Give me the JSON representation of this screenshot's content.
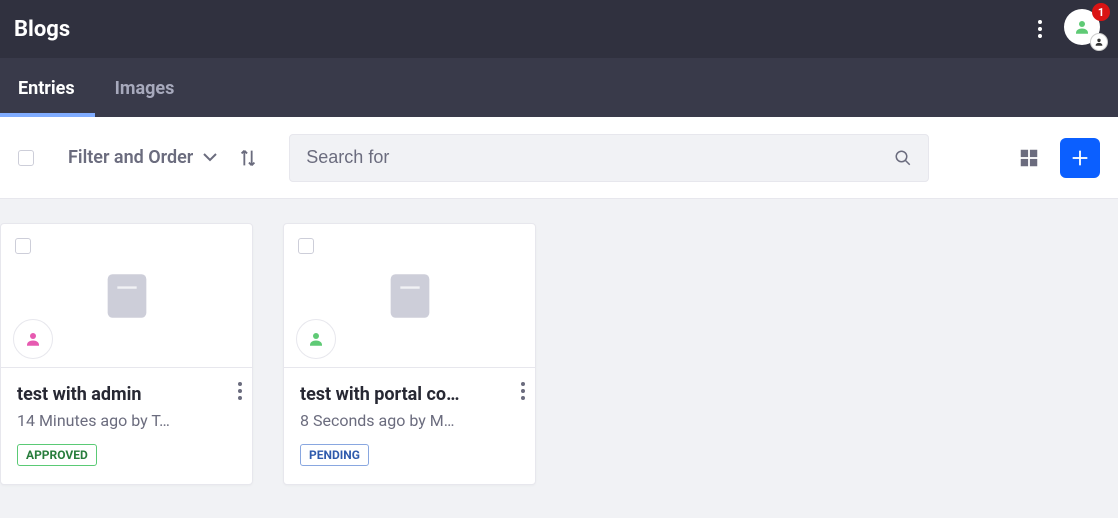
{
  "header": {
    "title": "Blogs",
    "notification_count": "1"
  },
  "tabs": [
    {
      "label": "Entries",
      "active": true
    },
    {
      "label": "Images",
      "active": false
    }
  ],
  "toolbar": {
    "filter_label": "Filter and Order",
    "search_placeholder": "Search for"
  },
  "cards": [
    {
      "title": "test with admin",
      "subtitle": "14 Minutes ago by T…",
      "status_label": "APPROVED",
      "status_kind": "approved",
      "author_color": "pink"
    },
    {
      "title": "test with portal co…",
      "subtitle": "8 Seconds ago by M…",
      "status_label": "PENDING",
      "status_kind": "pending",
      "author_color": "green"
    }
  ]
}
